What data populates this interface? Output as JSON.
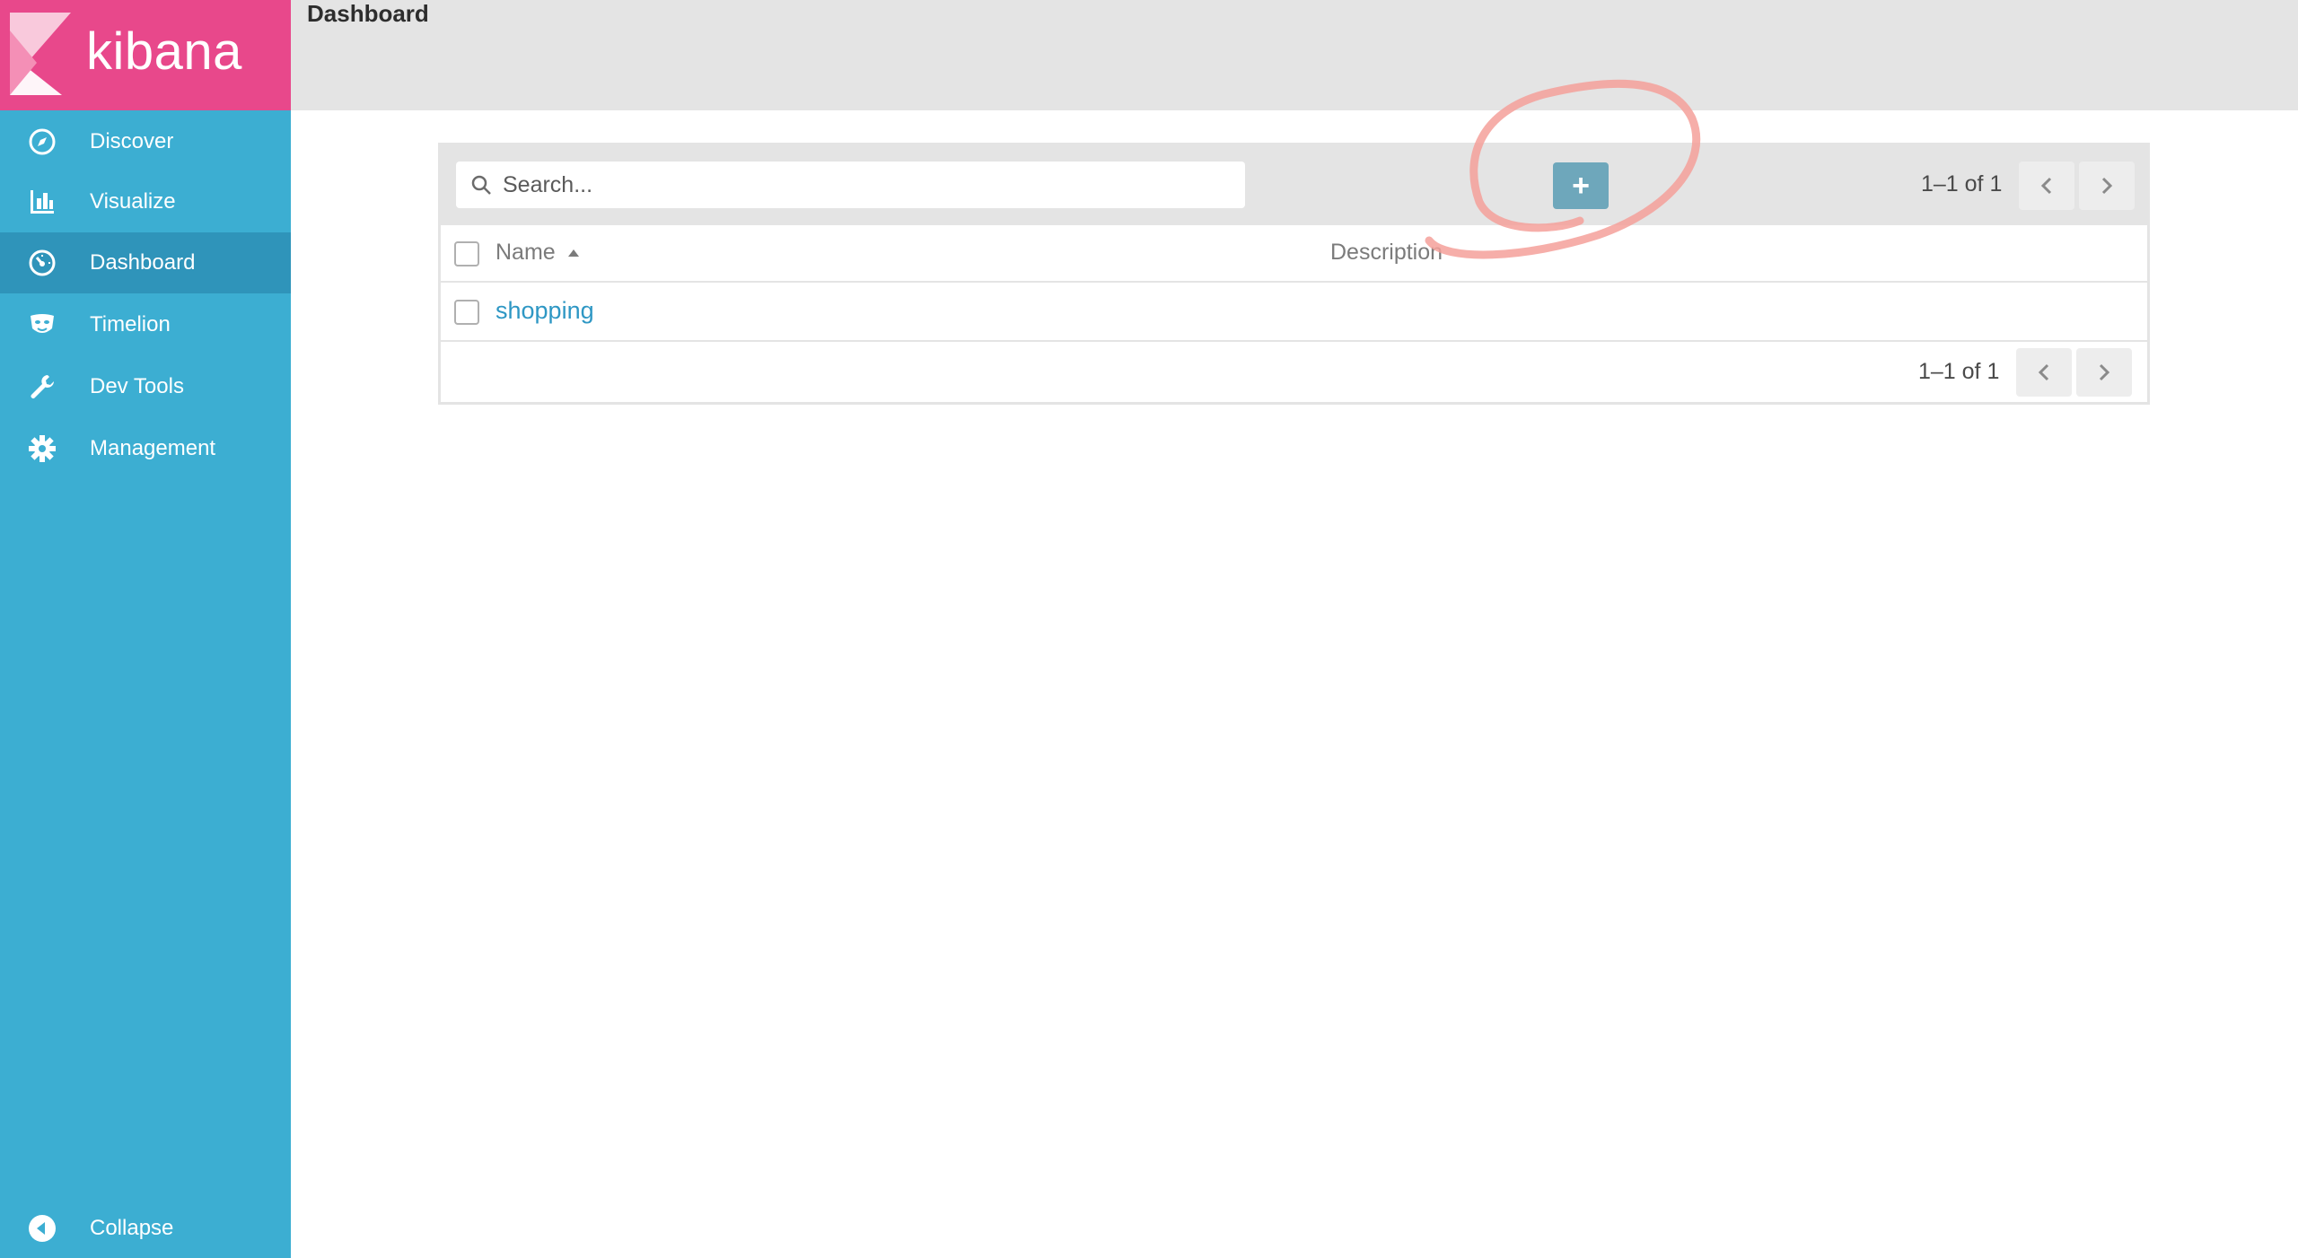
{
  "app": {
    "name": "kibana"
  },
  "sidebar": {
    "items": [
      {
        "label": "Discover",
        "icon": "compass-icon"
      },
      {
        "label": "Visualize",
        "icon": "bar-chart-icon"
      },
      {
        "label": "Dashboard",
        "icon": "dashboard-gauge-icon",
        "active": true
      },
      {
        "label": "Timelion",
        "icon": "timelion-mask-icon"
      },
      {
        "label": "Dev Tools",
        "icon": "wrench-icon"
      },
      {
        "label": "Management",
        "icon": "gear-icon"
      }
    ],
    "collapse_label": "Collapse"
  },
  "header": {
    "title": "Dashboard"
  },
  "search": {
    "placeholder": "Search..."
  },
  "toolbar": {
    "add_label": "+"
  },
  "pagination": {
    "top_text": "1–1 of 1",
    "bottom_text": "1–1 of 1"
  },
  "table": {
    "columns": [
      "Name",
      "Description"
    ],
    "rows": [
      {
        "name": "shopping",
        "description": ""
      }
    ]
  },
  "colors": {
    "sidebar": "#3caed2",
    "sidebar_active": "#2f94ba",
    "logo_bg": "#e8488b",
    "link": "#2e97c4",
    "add_button": "#6ea7bb",
    "annotation": "#f4a09a"
  }
}
